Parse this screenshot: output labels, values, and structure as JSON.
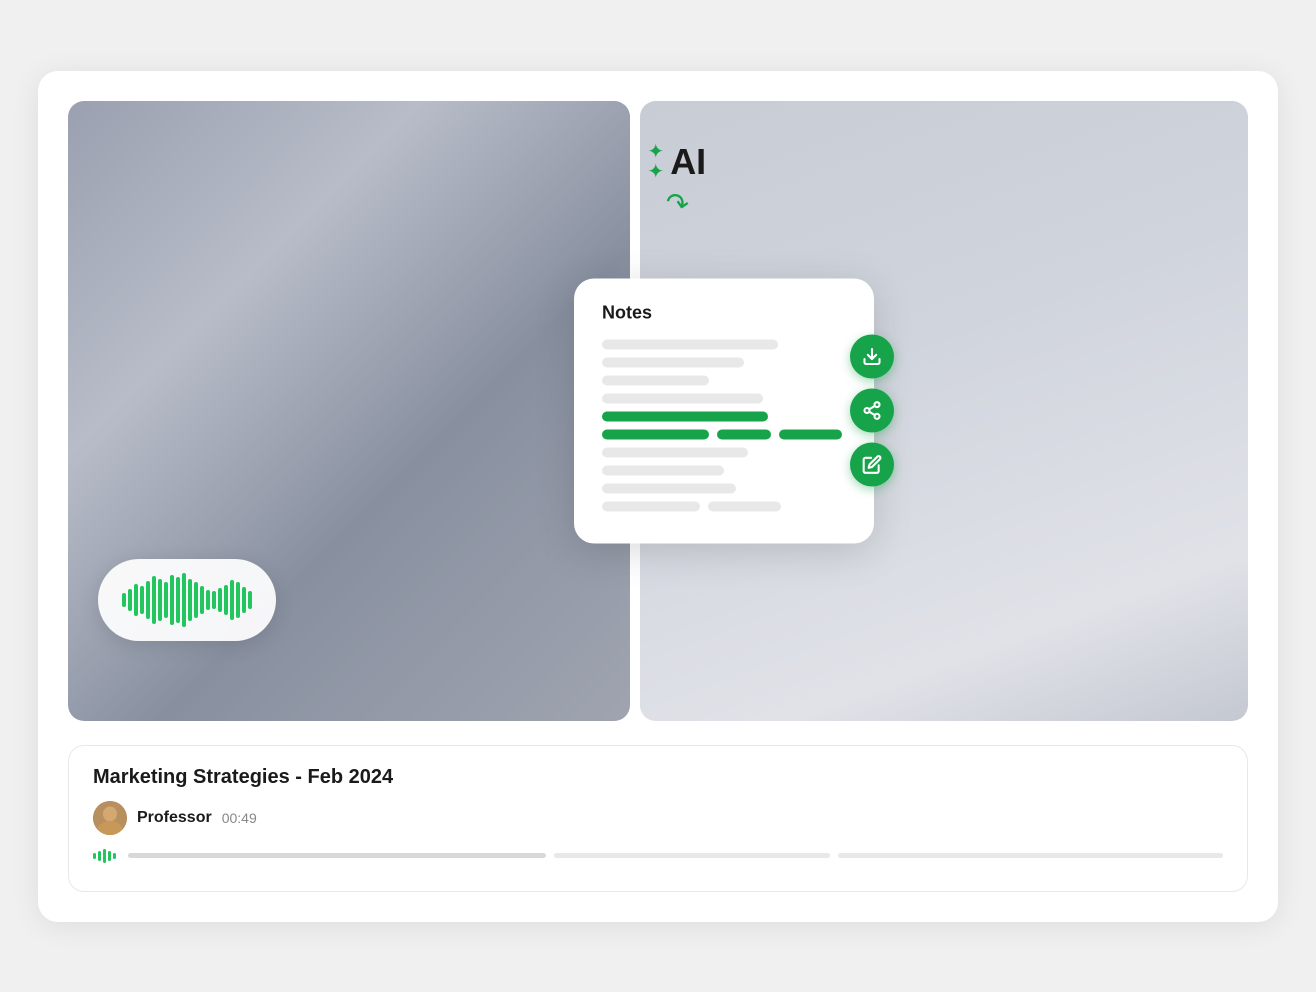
{
  "card": {
    "top_section": {
      "notes_card": {
        "title": "Notes",
        "ai_label": "AI",
        "action_buttons": [
          {
            "icon": "download",
            "label": "download-button"
          },
          {
            "icon": "share",
            "label": "share-button"
          },
          {
            "icon": "edit",
            "label": "edit-button"
          }
        ]
      }
    },
    "bottom_section": {
      "title": "Marketing Strategies - Feb 2024",
      "professor_name": "Professor",
      "duration": "00:49"
    }
  },
  "wave_bars": [
    12,
    22,
    35,
    28,
    40,
    50,
    44,
    38,
    52,
    48,
    55,
    45,
    38,
    30,
    22,
    18,
    25,
    32,
    42,
    38,
    28,
    20
  ],
  "mini_wave_bars": [
    6,
    10,
    14,
    10,
    6
  ],
  "note_lines": [
    {
      "width": "70%",
      "green": false
    },
    {
      "width": "55%",
      "green": false
    },
    {
      "width": "40%",
      "green": false
    },
    {
      "width": "65%",
      "green": false
    },
    {
      "width": "30%",
      "green": false
    }
  ],
  "progress_segments": [
    {
      "width": "38%",
      "filled": true
    },
    {
      "width": "25%",
      "filled": false
    },
    {
      "width": "35%",
      "filled": false
    }
  ],
  "colors": {
    "green": "#16a34a",
    "green_light": "#22c55e",
    "bg": "#f5f5f5"
  }
}
